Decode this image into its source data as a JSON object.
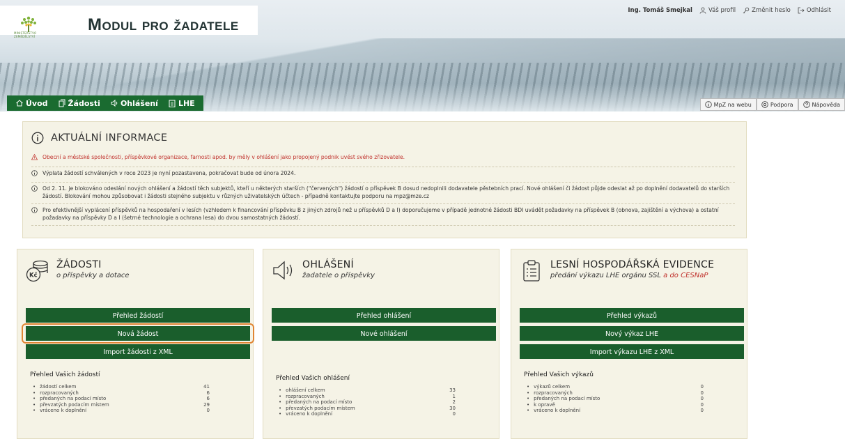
{
  "header": {
    "app_title": "Modul pro žadatele",
    "ministry_text": "MINISTERSTVO ZEMĚDĚLSTVÍ",
    "user_name": "Ing. Tomáš Smejkal",
    "profile_label": "Váš profil",
    "change_password_label": "Změnit heslo",
    "logout_label": "Odhlásit"
  },
  "nav": {
    "items": [
      {
        "label": "Úvod"
      },
      {
        "label": "Žádosti"
      },
      {
        "label": "Ohlášení"
      },
      {
        "label": "LHE"
      }
    ]
  },
  "toolbar": {
    "mpz_label": "MpZ na webu",
    "support_label": "Podpora",
    "help_label": "Nápověda"
  },
  "info": {
    "title": "AKTUÁLNÍ INFORMACE",
    "messages": [
      {
        "type": "warning",
        "text": "Obecní a městské společnosti, příspěvkové organizace, farnosti apod. by měly v ohlášení jako propojený podnik uvést svého zřizovatele."
      },
      {
        "type": "info",
        "text": "Výplata žádostí schválených v roce 2023 je nyní pozastavena, pokračovat bude od února 2024."
      },
      {
        "type": "info",
        "text": "Od 2. 11. je blokováno odeslání nových ohlášení a žádostí těch subjektů, kteří u některých starších (\"červených\") žádostí o příspěvek B dosud nedoplnili dodavatele pěstebních prací. Nové ohlášení či žádost půjde odeslat až po doplnění dodavatelů do starších žádostí. Blokování mohou způsobovat i žádosti stejného subjektu v různých uživatelských účtech - případně kontaktujte podporu na mpz@mze.cz"
      },
      {
        "type": "info",
        "text": "Pro efektivnější vyplácení příspěvků na hospodaření v lesích (vzhledem k financování příspěvku B z jiných zdrojů než u příspěvků D a I) doporučujeme v případě jednotné žádosti BDI uvádět požadavky na příspěvek B (obnova, zajištění a výchova) a ostatní požadavky na příspěvky D a I (šetrné technologie a ochrana lesa) do dvou samostatných žádostí."
      }
    ]
  },
  "cards": {
    "zadosti": {
      "title": "ŽÁDOSTI",
      "subtitle": "o příspěvky a dotace",
      "buttons": [
        "Přehled žádostí",
        "Nová žádost",
        "Import žádosti z XML"
      ],
      "stats_title": "Přehled Vašich žádostí",
      "stats": [
        {
          "label": "žádostí celkem",
          "value": "41"
        },
        {
          "label": "rozpracovaných",
          "value": "6"
        },
        {
          "label": "předaných na podací místo",
          "value": "6"
        },
        {
          "label": "převzatých podacím místem",
          "value": "29"
        },
        {
          "label": "vráceno k doplnění",
          "value": "0"
        }
      ]
    },
    "ohlaseni": {
      "title": "OHLÁŠENÍ",
      "subtitle": "žadatele o příspěvky",
      "buttons": [
        "Přehled ohlášení",
        "Nové ohlášení"
      ],
      "stats_title": "Přehled Vašich ohlášení",
      "stats": [
        {
          "label": "ohlášení celkem",
          "value": "33"
        },
        {
          "label": "rozpracovaných",
          "value": "1"
        },
        {
          "label": "předaných na podací místo",
          "value": "2"
        },
        {
          "label": "převzatých podacím místem",
          "value": "30"
        },
        {
          "label": "vráceno k doplnění",
          "value": "0"
        }
      ]
    },
    "lhe": {
      "title": "LESNÍ HOSPODÁŘSKÁ EVIDENCE",
      "subtitle_main": "předání výkazu LHE orgánu SSL",
      "subtitle_red": "a do CESNaP",
      "buttons": [
        "Přehled výkazů",
        "Nový výkaz LHE",
        "Import výkazu LHE z XML"
      ],
      "stats_title": "Přehled Vašich výkazů",
      "stats": [
        {
          "label": "výkazů celkem",
          "value": "0"
        },
        {
          "label": "rozpracovaných",
          "value": "0"
        },
        {
          "label": "předaných na podací místo",
          "value": "0"
        },
        {
          "label": "k opravě",
          "value": "0"
        },
        {
          "label": "vráceno k doplnění",
          "value": "0"
        }
      ]
    }
  },
  "colors": {
    "primary_green": "#1a5e2c",
    "panel_bg": "#f5f3e6",
    "warning_red": "#c0302b",
    "highlight_orange": "#e08533"
  }
}
